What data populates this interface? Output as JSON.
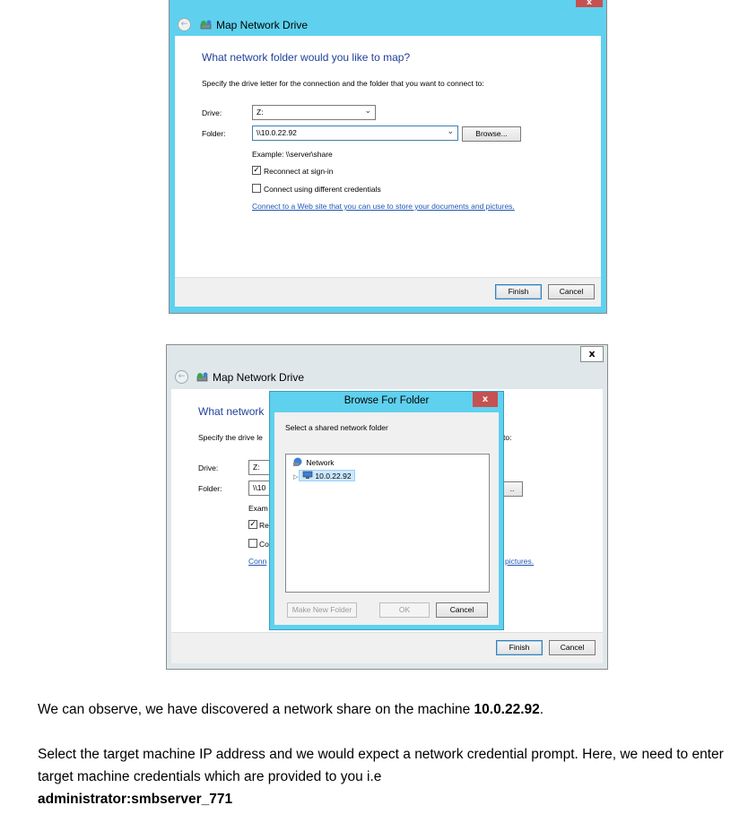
{
  "window1": {
    "title": "Map Network Drive",
    "close_glyph": "x",
    "heading": "What network folder would you like to map?",
    "instruction": "Specify the drive letter for the connection and the folder that you want to connect to:",
    "drive_label": "Drive:",
    "drive_value": "Z:",
    "folder_label": "Folder:",
    "folder_value": "\\\\10.0.22.92",
    "browse_label": "Browse...",
    "example": "Example: \\\\server\\share",
    "reconnect_label": "Reconnect at sign-in",
    "reconnect_checked": true,
    "credentials_label": "Connect using different credentials",
    "credentials_checked": false,
    "link": "Connect to a Web site that you can use to store your documents and pictures.",
    "finish_label": "Finish",
    "cancel_label": "Cancel"
  },
  "window2": {
    "title": "Map Network Drive",
    "close_glyph": "x",
    "heading_partial": "What network",
    "instruction_partial": "Specify the drive le",
    "instruction_tail": "to:",
    "drive_label": "Drive:",
    "drive_value": "Z:",
    "folder_label": "Folder:",
    "folder_value_partial": "\\\\10",
    "browse_partial": "..",
    "example_partial": "Exam",
    "reconnect_partial": "Re",
    "credentials_partial": "Co",
    "link_partial": "Conn",
    "link_tail": "pictures.",
    "finish_label": "Finish",
    "cancel_label": "Cancel"
  },
  "browse_dialog": {
    "title": "Browse For Folder",
    "close_glyph": "x",
    "prompt": "Select a shared network folder",
    "tree": [
      {
        "label": "Network",
        "icon": "network-icon"
      },
      {
        "label": "10.0.22.92",
        "icon": "computer-icon",
        "selected": true
      }
    ],
    "make_new_folder_label": "Make New Folder",
    "ok_label": "OK",
    "cancel_label": "Cancel"
  },
  "prose": {
    "p1_text": "We can observe, we have discovered a network share on the machine ",
    "p1_bold": "10.0.22.92",
    "p1_end": ".",
    "p2_text": "Select the target machine IP address and we would expect a network credential prompt. Here, we need to enter target machine credentials which are provided to you i.e",
    "p2_bold": "administrator:smbserver_771"
  }
}
